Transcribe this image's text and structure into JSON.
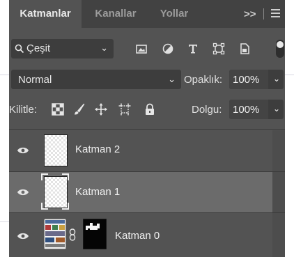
{
  "tabs": {
    "items": [
      {
        "label": "Katmanlar",
        "active": true
      },
      {
        "label": "Kanallar",
        "active": false
      },
      {
        "label": "Yollar",
        "active": false
      }
    ],
    "overflow_label": ">>"
  },
  "filter": {
    "kind_label": "Çeşit",
    "icons": [
      "image-filter-icon",
      "adjustment-filter-icon",
      "type-filter-icon",
      "shape-filter-icon",
      "smart-object-filter-icon"
    ]
  },
  "blend": {
    "mode": "Normal",
    "opacity_label": "Opaklık:",
    "opacity_value": "100%"
  },
  "lock": {
    "label": "Kilitle:",
    "fill_label": "Dolgu:",
    "fill_value": "100%"
  },
  "layers": [
    {
      "name": "Katman 2",
      "visible": true,
      "selected": false
    },
    {
      "name": "Katman 1",
      "visible": true,
      "selected": true
    },
    {
      "name": "Katman 0",
      "visible": true,
      "selected": false,
      "has_mask": true
    }
  ],
  "colors": {
    "panel_bg": "#535353",
    "tab_bar_bg": "#424242",
    "selected_row": "#6b6b6b",
    "field_bg": "#3d3d3d"
  }
}
